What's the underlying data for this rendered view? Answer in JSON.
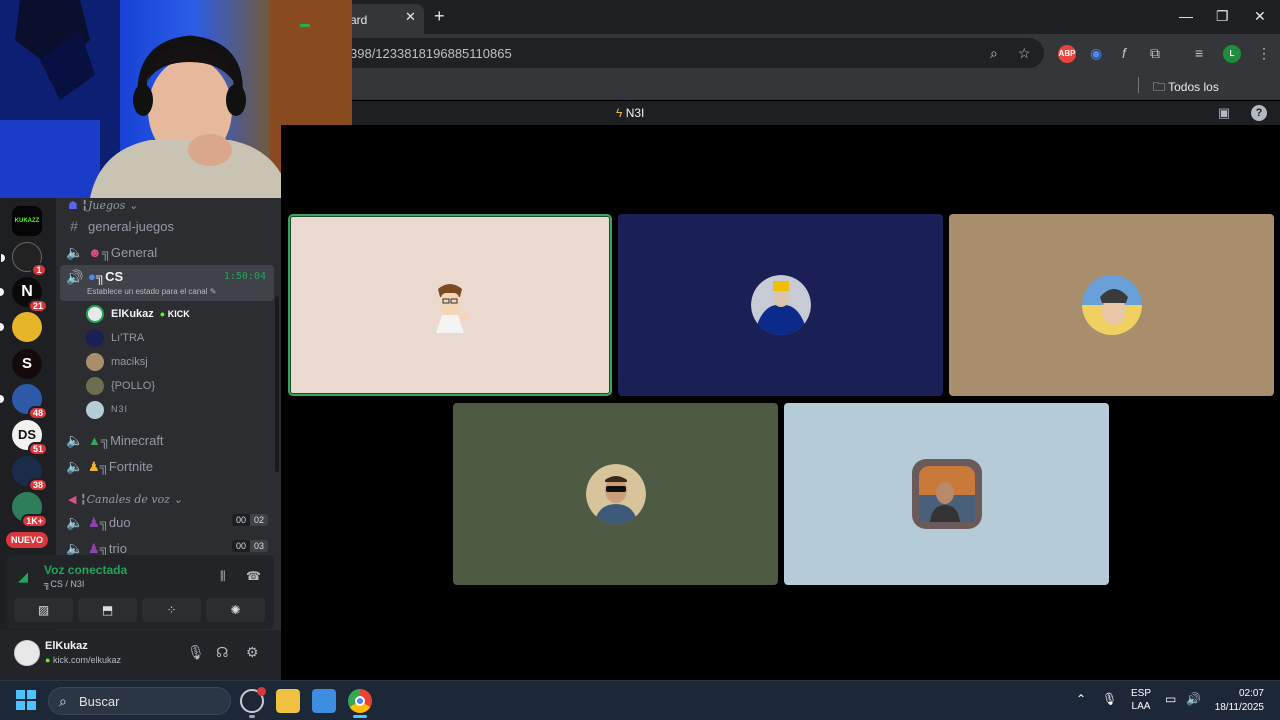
{
  "browser": {
    "tab_title": "ard",
    "tab_close": "✕",
    "new_tab": "+",
    "url": "398/1233818196885110865",
    "bookmarks_folder": "Todos los marcadores",
    "window_controls": [
      "—",
      "❐",
      "✕"
    ],
    "extensions": [
      "ABP",
      "f",
      "L"
    ]
  },
  "discord": {
    "title": "N3I",
    "servers": [
      {
        "label": "KUKAZZ",
        "badge": ""
      },
      {
        "label": "",
        "badge": "1"
      },
      {
        "label": "N",
        "badge": "21"
      },
      {
        "label": "",
        "badge": ""
      },
      {
        "label": "S",
        "badge": ""
      },
      {
        "label": "",
        "badge": "48"
      },
      {
        "label": "DS",
        "badge": "51"
      },
      {
        "label": "",
        "badge": "38"
      },
      {
        "label": "",
        "badge": "1K+"
      }
    ],
    "new_badge": "NUEVO",
    "categories": {
      "games": "╏Juegos ⌄",
      "voice": "╏Canales de voz ⌄"
    },
    "channels": {
      "general_games": "general-juegos",
      "general": "╗General",
      "cs": "╗CS",
      "cs_timer": "1:50:04",
      "cs_status": "Establece un estado para el canal ✎",
      "minecraft": "╗Minecraft",
      "fortnite": "╗Fortnite",
      "duo": "╗duo",
      "duo_count": [
        "00",
        "02"
      ],
      "trio": "╗trio",
      "trio_count": [
        "00",
        "03"
      ]
    },
    "members": [
      {
        "name": "ElKukaz",
        "kick": "KICK"
      },
      {
        "name": "Lı'TRA"
      },
      {
        "name": "maciksj"
      },
      {
        "name": "{POLLO}"
      },
      {
        "name": "N3I"
      }
    ],
    "voice": {
      "title": "Voz conectada",
      "subtitle": "╗CS / N3I"
    },
    "user": {
      "name": "ElKukaz",
      "status": "kick.com/elkukaz"
    }
  },
  "colors": {
    "tile1": "#e9d9cf",
    "tile2": "#1a1f55",
    "tile3": "#a98e6d",
    "tile4": "#4f5a45",
    "tile5": "#b5cbd8",
    "speaking": "#3ba55d",
    "discord_green": "#23a55a"
  },
  "taskbar": {
    "search": "Buscar",
    "lang_top": "ESP",
    "lang_bottom": "LAA",
    "time": "02:07",
    "date": "18/11/2025"
  }
}
